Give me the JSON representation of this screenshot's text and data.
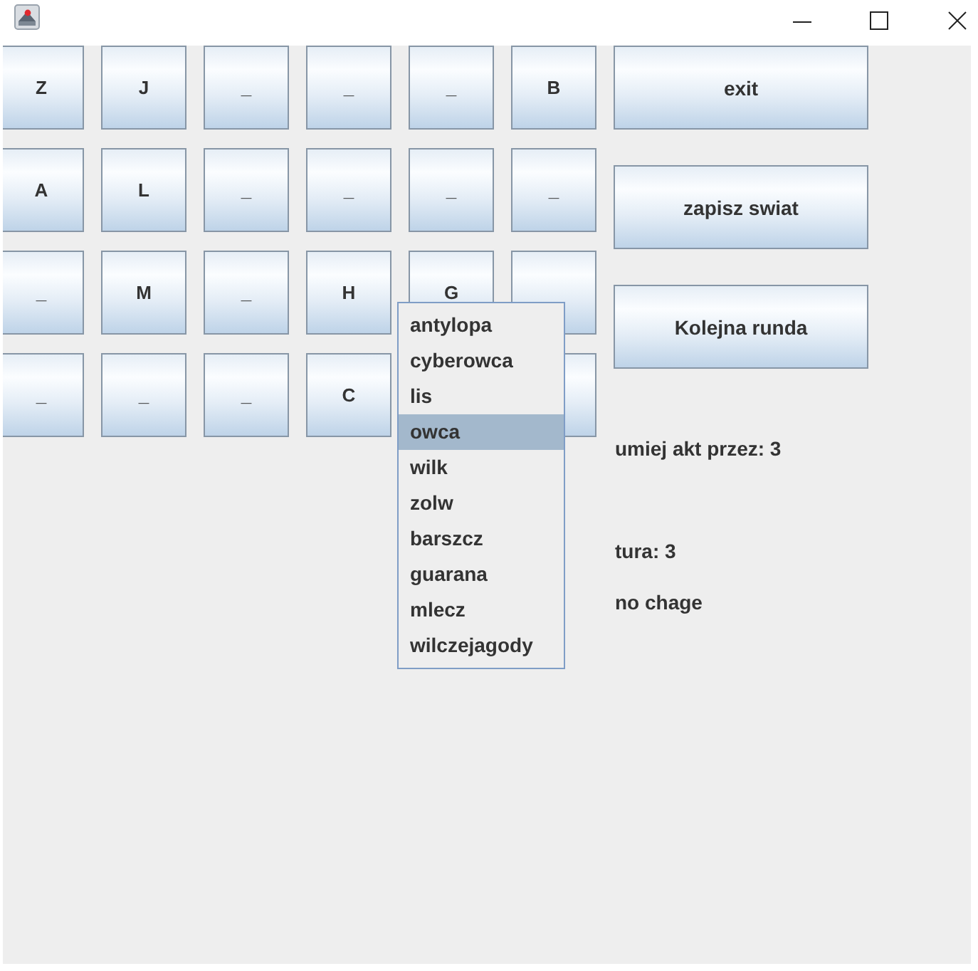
{
  "grid": {
    "rows": [
      [
        {
          "kind": "key",
          "label": "Z"
        },
        {
          "kind": "key",
          "label": "J"
        },
        {
          "kind": "key",
          "label": "_"
        },
        {
          "kind": "key",
          "label": "_"
        },
        {
          "kind": "key",
          "label": "_"
        },
        {
          "kind": "key",
          "label": "B"
        }
      ],
      [
        {
          "kind": "key",
          "label": "A"
        },
        {
          "kind": "key",
          "label": "L"
        },
        {
          "kind": "key",
          "label": "_"
        },
        {
          "kind": "key",
          "label": "_"
        },
        {
          "kind": "key",
          "label": "_"
        },
        {
          "kind": "key",
          "label": "_"
        }
      ],
      [
        {
          "kind": "key",
          "label": "_"
        },
        {
          "kind": "key",
          "label": "M"
        },
        {
          "kind": "key",
          "label": "_"
        },
        {
          "kind": "key",
          "label": "H"
        },
        {
          "kind": "key",
          "label": "G"
        },
        {
          "kind": "blank"
        }
      ],
      [
        {
          "kind": "key",
          "label": "_"
        },
        {
          "kind": "key",
          "label": "_"
        },
        {
          "kind": "key",
          "label": "_"
        },
        {
          "kind": "key",
          "label": "C"
        },
        null,
        {
          "kind": "blank"
        }
      ]
    ]
  },
  "actions": [
    {
      "label": "exit"
    },
    {
      "label": "zapisz swiat"
    },
    {
      "label": "Kolejna runda"
    }
  ],
  "status": [
    {
      "text": "umiej akt przez: 3"
    },
    {
      "text": "tura: 3"
    },
    {
      "text": "no chage"
    }
  ],
  "dropdown_list": {
    "items": [
      {
        "label": "antylopa",
        "selected": false
      },
      {
        "label": "cyberowca",
        "selected": false
      },
      {
        "label": "lis",
        "selected": false
      },
      {
        "label": "owca",
        "selected": true
      },
      {
        "label": "wilk",
        "selected": false
      },
      {
        "label": "zolw",
        "selected": false
      },
      {
        "label": "barszcz",
        "selected": false
      },
      {
        "label": "guarana",
        "selected": false
      },
      {
        "label": "mlecz",
        "selected": false
      },
      {
        "label": "wilczejagody",
        "selected": false
      }
    ]
  }
}
